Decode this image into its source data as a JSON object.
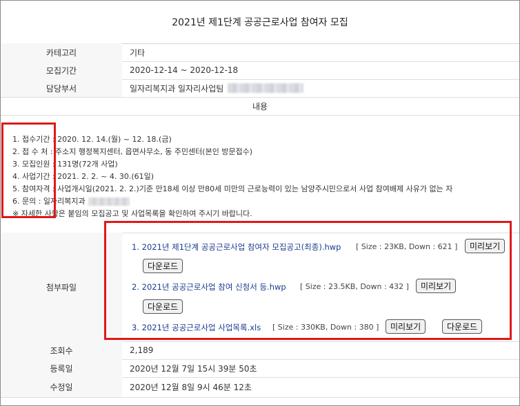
{
  "title": "2021년 제1단계 공공근로사업 참여자 모집",
  "rows": [
    {
      "label": "카테고리",
      "value": "기타"
    },
    {
      "label": "모집기간",
      "value": "2020-12-14 ~ 2020-12-18"
    },
    {
      "label": "담당부서",
      "value": "일자리복지과 일자리사업팀"
    }
  ],
  "content_label": "내용",
  "content_lines": [
    "1. 접수기간 : 2020. 12. 14.(월) ~ 12. 18.(금)",
    "2. 접 수 처 : 주소지 행정복지센터, 읍면사무소, 동 주민센터(본인 방문접수)",
    "3. 모집인원 : 131명(72개 사업)",
    "4. 사업기간 : 2021. 2. 2. ~ 4. 30.(61일)",
    "5. 참여자격 : 사업개시일(2021. 2. 2.)기준 만18세 이상 만80세 미만의 근로능력이 있는 남양주시민으로서 사업 참여배제 사유가 없는 자",
    "6. 문의 : 일자리복지과",
    " ※ 자세한 사항은 붙임의 모집공고 및 사업목록을 확인하여 주시기 바랍니다."
  ],
  "attachments_label": "첨부파일",
  "attachments": [
    {
      "name": "1. 2021년 제1단계 공공근로사업 참여자 모집공고(최종).hwp",
      "meta": "[ Size : 23KB, Down : 621 ]"
    },
    {
      "name": "2. 2021년 공공근로사업 참여 신청서 등.hwp",
      "meta": "[ Size : 23.5KB, Down : 432 ]"
    },
    {
      "name": "3. 2021년 공공근로사업 사업목록.xls",
      "meta": "[ Size : 330KB, Down : 380 ]"
    }
  ],
  "buttons": {
    "preview": "미리보기",
    "download": "다운로드"
  },
  "meta_rows": [
    {
      "label": "조회수",
      "value": "2,189"
    },
    {
      "label": "등록일",
      "value": "2020년 12월 7일 15시 39분 50초"
    },
    {
      "label": "수정일",
      "value": "2020년 12월 8일 9시 46분 12초"
    }
  ],
  "colors": {
    "highlight": "#e01818",
    "link": "#1a3a8f",
    "header_bg": "#f7f7f7"
  }
}
